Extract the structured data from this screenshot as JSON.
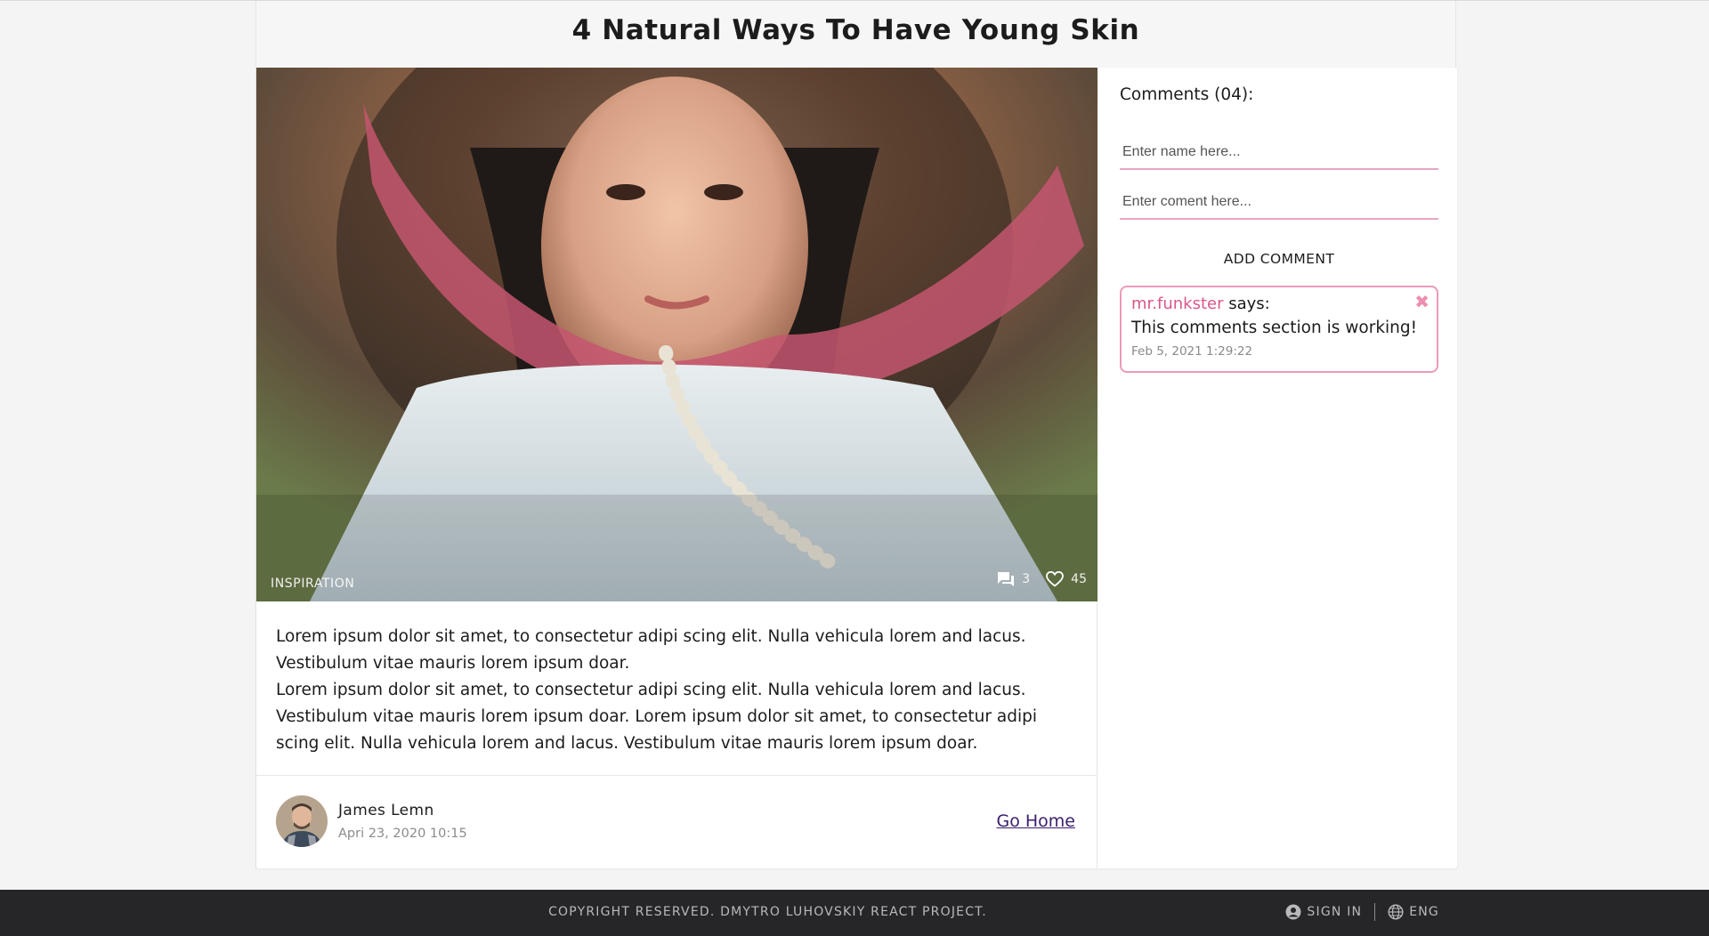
{
  "article": {
    "title": "4 Natural Ways To Have Young Skin",
    "category": "INSPIRATION",
    "comments_count": "3",
    "likes_count": "45",
    "paragraphs": [
      "Lorem ipsum dolor sit amet, to consectetur adipi scing elit. Nulla vehicula lorem and lacus. Vestibulum vitae mauris lorem ipsum doar.",
      "Lorem ipsum dolor sit amet, to consectetur adipi scing elit. Nulla vehicula lorem and lacus. Vestibulum vitae mauris lorem ipsum doar. Lorem ipsum dolor sit amet, to consectetur adipi scing elit. Nulla vehicula lorem and lacus. Vestibulum vitae mauris lorem ipsum doar."
    ],
    "author": {
      "name": "James Lemn",
      "date": "Apri 23, 2020 10:15"
    },
    "go_home": "Go Home"
  },
  "comments": {
    "title": "Comments (04):",
    "name_placeholder": "Enter name here...",
    "comment_placeholder": "Enter coment here...",
    "add_label": "ADD COMMENT",
    "items": [
      {
        "author": "mr.funkster",
        "says": "says:",
        "text": "This comments section is working!",
        "date": "Feb 5, 2021 1:29:22",
        "close_icon": "✖"
      }
    ]
  },
  "footer": {
    "copyright": "COPYRIGHT RESERVED. DMYTRO LUHOVSKIY REACT PROJECT.",
    "sign_in": "SIGN IN",
    "language": "ENG"
  },
  "icons": {
    "comment": "comment-bubble-icon",
    "like": "heart-icon",
    "user": "user-circle-icon",
    "globe": "globe-icon",
    "close": "close-icon"
  },
  "colors": {
    "accent_pink": "#ec9ab9",
    "author_pink": "#d9568a",
    "link_purple": "#3c1f6e",
    "footer_bg": "#262628"
  }
}
